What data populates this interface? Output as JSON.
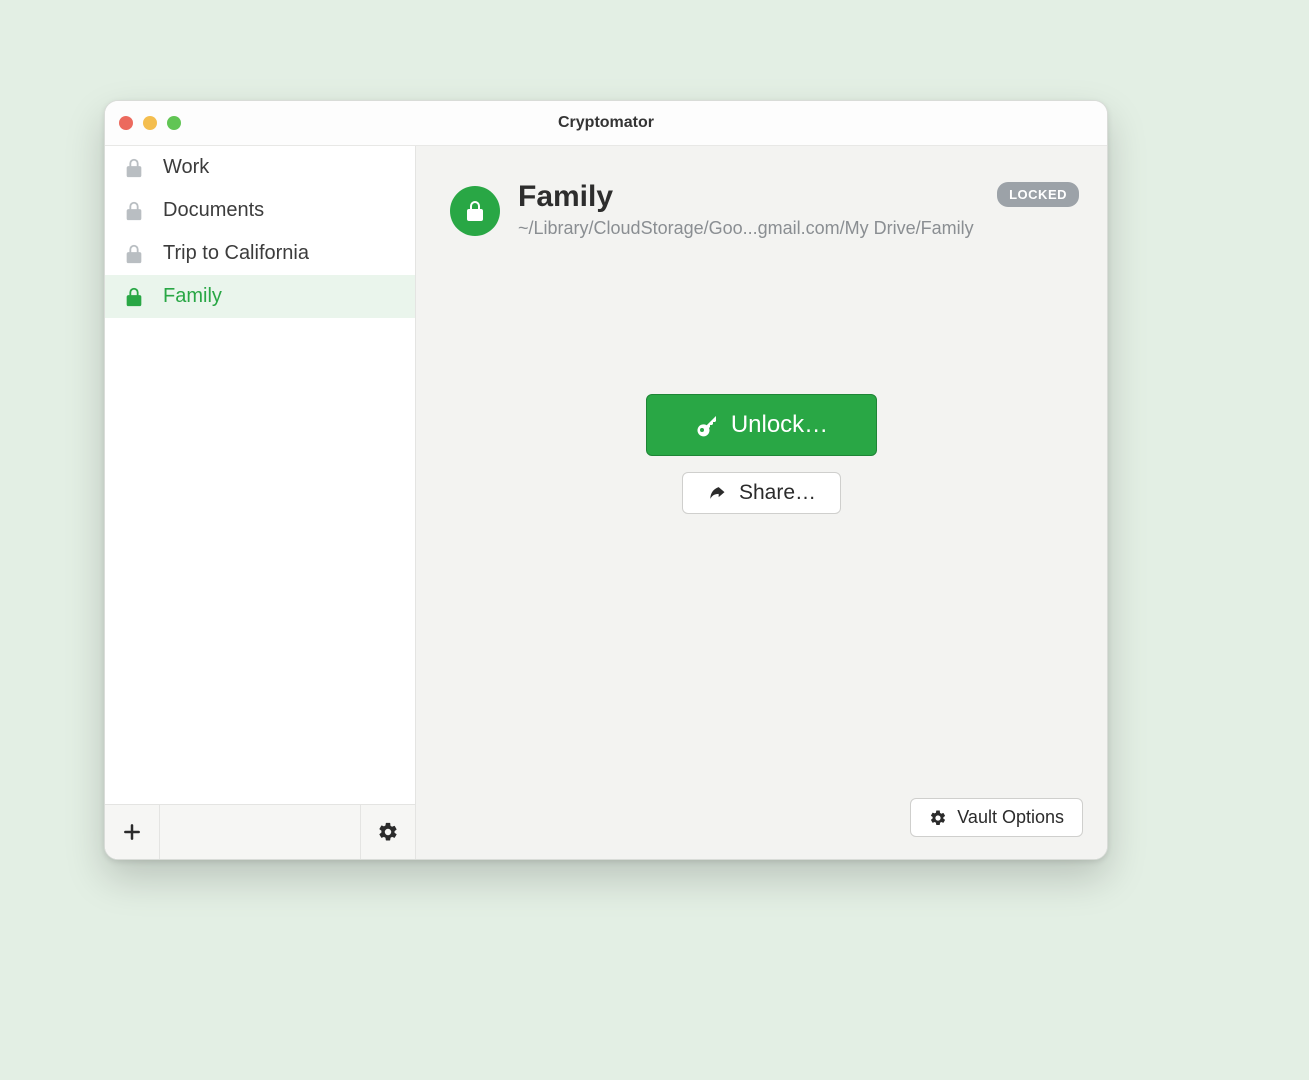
{
  "window": {
    "title": "Cryptomator"
  },
  "sidebar": {
    "items": [
      {
        "label": "Work",
        "selected": false
      },
      {
        "label": "Documents",
        "selected": false
      },
      {
        "label": "Trip to California",
        "selected": false
      },
      {
        "label": "Family",
        "selected": true
      }
    ]
  },
  "detail": {
    "title": "Family",
    "path": "~/Library/CloudStorage/Goo...gmail.com/My Drive/Family",
    "status": "LOCKED",
    "unlock_label": "Unlock…",
    "share_label": "Share…",
    "vault_options_label": "Vault Options"
  }
}
